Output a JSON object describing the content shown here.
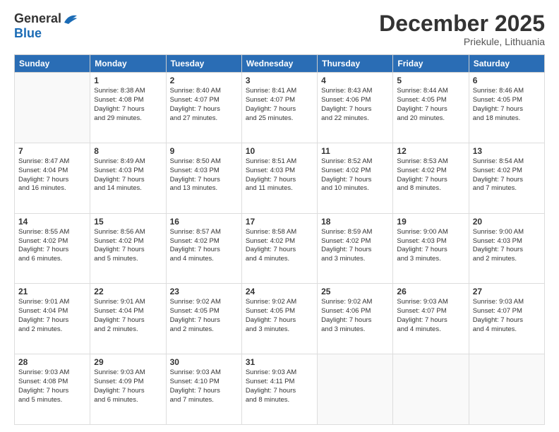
{
  "logo": {
    "general": "General",
    "blue": "Blue"
  },
  "title": "December 2025",
  "subtitle": "Priekule, Lithuania",
  "days_of_week": [
    "Sunday",
    "Monday",
    "Tuesday",
    "Wednesday",
    "Thursday",
    "Friday",
    "Saturday"
  ],
  "weeks": [
    [
      {
        "day": "",
        "info": ""
      },
      {
        "day": "1",
        "info": "Sunrise: 8:38 AM\nSunset: 4:08 PM\nDaylight: 7 hours\nand 29 minutes."
      },
      {
        "day": "2",
        "info": "Sunrise: 8:40 AM\nSunset: 4:07 PM\nDaylight: 7 hours\nand 27 minutes."
      },
      {
        "day": "3",
        "info": "Sunrise: 8:41 AM\nSunset: 4:07 PM\nDaylight: 7 hours\nand 25 minutes."
      },
      {
        "day": "4",
        "info": "Sunrise: 8:43 AM\nSunset: 4:06 PM\nDaylight: 7 hours\nand 22 minutes."
      },
      {
        "day": "5",
        "info": "Sunrise: 8:44 AM\nSunset: 4:05 PM\nDaylight: 7 hours\nand 20 minutes."
      },
      {
        "day": "6",
        "info": "Sunrise: 8:46 AM\nSunset: 4:05 PM\nDaylight: 7 hours\nand 18 minutes."
      }
    ],
    [
      {
        "day": "7",
        "info": "Sunrise: 8:47 AM\nSunset: 4:04 PM\nDaylight: 7 hours\nand 16 minutes."
      },
      {
        "day": "8",
        "info": "Sunrise: 8:49 AM\nSunset: 4:03 PM\nDaylight: 7 hours\nand 14 minutes."
      },
      {
        "day": "9",
        "info": "Sunrise: 8:50 AM\nSunset: 4:03 PM\nDaylight: 7 hours\nand 13 minutes."
      },
      {
        "day": "10",
        "info": "Sunrise: 8:51 AM\nSunset: 4:03 PM\nDaylight: 7 hours\nand 11 minutes."
      },
      {
        "day": "11",
        "info": "Sunrise: 8:52 AM\nSunset: 4:02 PM\nDaylight: 7 hours\nand 10 minutes."
      },
      {
        "day": "12",
        "info": "Sunrise: 8:53 AM\nSunset: 4:02 PM\nDaylight: 7 hours\nand 8 minutes."
      },
      {
        "day": "13",
        "info": "Sunrise: 8:54 AM\nSunset: 4:02 PM\nDaylight: 7 hours\nand 7 minutes."
      }
    ],
    [
      {
        "day": "14",
        "info": "Sunrise: 8:55 AM\nSunset: 4:02 PM\nDaylight: 7 hours\nand 6 minutes."
      },
      {
        "day": "15",
        "info": "Sunrise: 8:56 AM\nSunset: 4:02 PM\nDaylight: 7 hours\nand 5 minutes."
      },
      {
        "day": "16",
        "info": "Sunrise: 8:57 AM\nSunset: 4:02 PM\nDaylight: 7 hours\nand 4 minutes."
      },
      {
        "day": "17",
        "info": "Sunrise: 8:58 AM\nSunset: 4:02 PM\nDaylight: 7 hours\nand 4 minutes."
      },
      {
        "day": "18",
        "info": "Sunrise: 8:59 AM\nSunset: 4:02 PM\nDaylight: 7 hours\nand 3 minutes."
      },
      {
        "day": "19",
        "info": "Sunrise: 9:00 AM\nSunset: 4:03 PM\nDaylight: 7 hours\nand 3 minutes."
      },
      {
        "day": "20",
        "info": "Sunrise: 9:00 AM\nSunset: 4:03 PM\nDaylight: 7 hours\nand 2 minutes."
      }
    ],
    [
      {
        "day": "21",
        "info": "Sunrise: 9:01 AM\nSunset: 4:04 PM\nDaylight: 7 hours\nand 2 minutes."
      },
      {
        "day": "22",
        "info": "Sunrise: 9:01 AM\nSunset: 4:04 PM\nDaylight: 7 hours\nand 2 minutes."
      },
      {
        "day": "23",
        "info": "Sunrise: 9:02 AM\nSunset: 4:05 PM\nDaylight: 7 hours\nand 2 minutes."
      },
      {
        "day": "24",
        "info": "Sunrise: 9:02 AM\nSunset: 4:05 PM\nDaylight: 7 hours\nand 3 minutes."
      },
      {
        "day": "25",
        "info": "Sunrise: 9:02 AM\nSunset: 4:06 PM\nDaylight: 7 hours\nand 3 minutes."
      },
      {
        "day": "26",
        "info": "Sunrise: 9:03 AM\nSunset: 4:07 PM\nDaylight: 7 hours\nand 4 minutes."
      },
      {
        "day": "27",
        "info": "Sunrise: 9:03 AM\nSunset: 4:07 PM\nDaylight: 7 hours\nand 4 minutes."
      }
    ],
    [
      {
        "day": "28",
        "info": "Sunrise: 9:03 AM\nSunset: 4:08 PM\nDaylight: 7 hours\nand 5 minutes."
      },
      {
        "day": "29",
        "info": "Sunrise: 9:03 AM\nSunset: 4:09 PM\nDaylight: 7 hours\nand 6 minutes."
      },
      {
        "day": "30",
        "info": "Sunrise: 9:03 AM\nSunset: 4:10 PM\nDaylight: 7 hours\nand 7 minutes."
      },
      {
        "day": "31",
        "info": "Sunrise: 9:03 AM\nSunset: 4:11 PM\nDaylight: 7 hours\nand 8 minutes."
      },
      {
        "day": "",
        "info": ""
      },
      {
        "day": "",
        "info": ""
      },
      {
        "day": "",
        "info": ""
      }
    ]
  ]
}
